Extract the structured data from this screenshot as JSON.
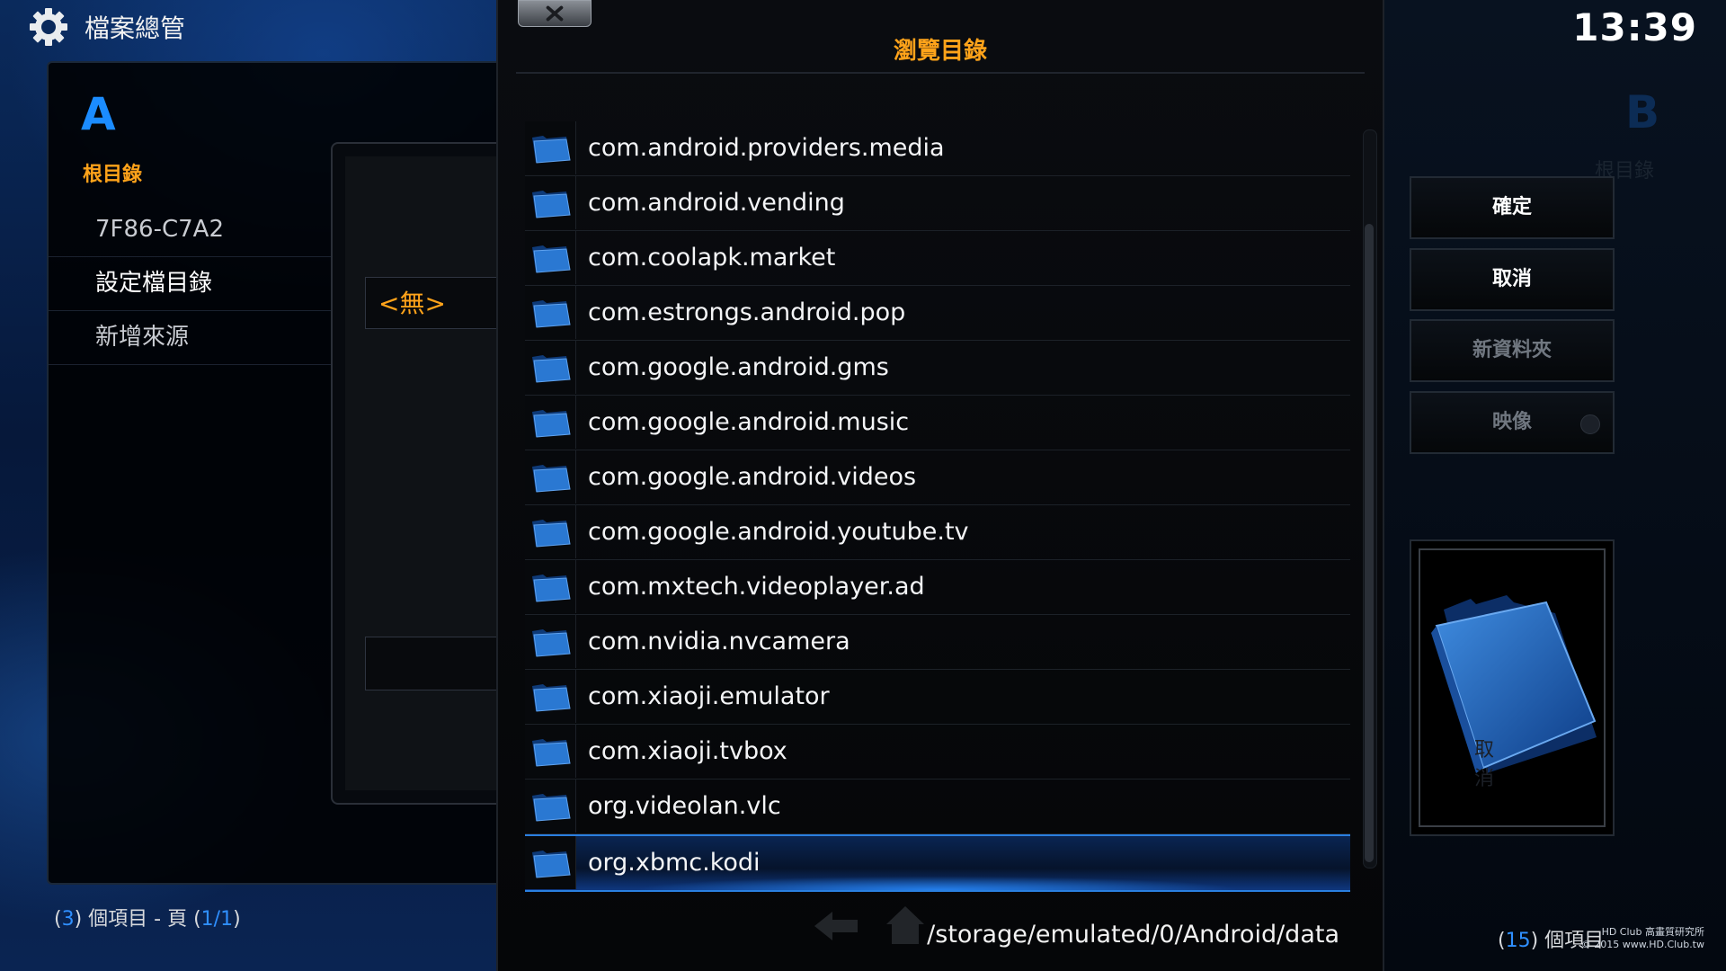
{
  "header": {
    "title": "檔案總管"
  },
  "clock": "13:39",
  "panel_a": {
    "letter": "A",
    "subtitle": "根目錄",
    "items": [
      "7F86-C7A2",
      "設定檔目錄",
      "新增來源"
    ],
    "footer": {
      "open": "(",
      "count": "3",
      "mid": ") 個項目 - 頁 (",
      "page": "1/1",
      "close": ")"
    }
  },
  "source_dialog": {
    "none_value": "<無>"
  },
  "browse_dialog": {
    "title": "瀏覽目錄",
    "items": [
      "com.android.providers.media",
      "com.android.vending",
      "com.coolapk.market",
      "com.estrongs.android.pop",
      "com.google.android.gms",
      "com.google.android.music",
      "com.google.android.videos",
      "com.google.android.youtube.tv",
      "com.mxtech.videoplayer.ad",
      "com.nvidia.nvcamera",
      "com.xiaoji.emulator",
      "com.xiaoji.tvbox",
      "org.videolan.vlc",
      "org.xbmc.kodi"
    ],
    "selected_index": 13,
    "path": "/storage/emulated/0/Android/data",
    "ghost_cancel": "取消"
  },
  "side_buttons": {
    "ok": "確定",
    "cancel": "取消",
    "new_folder": "新資料夾",
    "mirror": "映像"
  },
  "panel_b": {
    "letter": "B",
    "subtitle": "根目錄",
    "footer": {
      "open": "(",
      "count": "15",
      "mid": ") 個項目"
    }
  },
  "watermark": {
    "line1": "HD Club 高畫質研究所",
    "line2": "© 2015  www.HD.Club.tw"
  },
  "colors": {
    "accent_orange": "#ffa31a",
    "accent_blue": "#1b8cff",
    "selection": "#2a7fe0"
  }
}
